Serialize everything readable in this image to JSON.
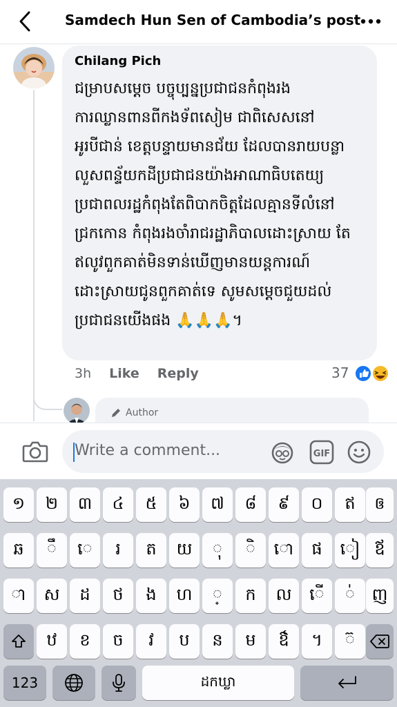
{
  "header": {
    "title": "Samdech Hun Sen of Cambodia’s post",
    "back_icon": "chevron-left-icon",
    "more_icon": "more-dots-icon"
  },
  "comment": {
    "author": "Chilang Pich",
    "lines": [
      "ជម្រាបសម្តេច បច្ចុប្បន្នប្រជាជនកំពុងរង",
      "ការឈ្លានពានពីកងទ័ពសៀម ជាពិសេសនៅ",
      "អូរបីជាន់ ខេត្តបន្ទាយមានជ័យ ដែលបានរាយបន្លា",
      "លួសពន្ទ័យកដីប្រជាជនយ៉ាងអាណាធិបតេយ្យ",
      "ប្រជាពលរដ្ឋកំពុងតែពិបាកចិត្តដែលគ្មានទីលំនៅ",
      "ជ្រកកោន កំពុងរងចាំរាជរដ្ឋាភិបាលដោះស្រាយ តែ",
      "ឥលូវពួកគាត់មិនទាន់ឃើញមានយន្តការណ៍",
      "ដោះស្រាយជូនពួកគាត់ទេ សូមសម្តេចជួយដល់",
      "ប្រជាជនយើងផង 🙏🙏🙏។"
    ],
    "time": "3h",
    "like_label": "Like",
    "reply_label": "Reply",
    "reaction_count": "37",
    "reaction_icons": [
      "like-reaction-icon",
      "haha-reaction-icon"
    ]
  },
  "reply": {
    "badge_label": "Author",
    "badge_icon": "pen-icon"
  },
  "composer": {
    "placeholder": "Write a comment...",
    "camera_icon": "camera-icon",
    "avatar_icon": "avatar-sticker-icon",
    "gif_label": "GIF",
    "emoji_icon": "emoji-icon"
  },
  "keyboard": {
    "row1": [
      "១",
      "២",
      "៣",
      "៤",
      "៥",
      "៦",
      "៧",
      "៨",
      "៩",
      "០",
      "ឥ",
      "ឲ"
    ],
    "row2": [
      "ឆ",
      "ឹ",
      "េ",
      "រ",
      "ត",
      "យ",
      "ុ",
      "ិ",
      "ោ",
      "ផ",
      "ៀ",
      "ឪ"
    ],
    "row3": [
      "ា",
      "ស",
      "ដ",
      "ថ",
      "ង",
      "ហ",
      "្",
      "ក",
      "ល",
      "ើ",
      "់",
      "ញ"
    ],
    "row4": [
      "ឋ",
      "ខ",
      "ច",
      "វ",
      "ប",
      "ន",
      "ម",
      "ឳ",
      "។",
      "៊"
    ],
    "numbers_label": "123",
    "space_label": "ដកឃ្លា",
    "shift_icon": "shift-icon",
    "delete_icon": "backspace-icon",
    "globe_icon": "globe-icon",
    "mic_icon": "microphone-icon",
    "return_icon": "return-icon"
  },
  "colors": {
    "accent": "#1877f2",
    "bubble": "#f0f2f5",
    "muted": "#65676b",
    "keyboard_bg": "#d1d4da"
  }
}
